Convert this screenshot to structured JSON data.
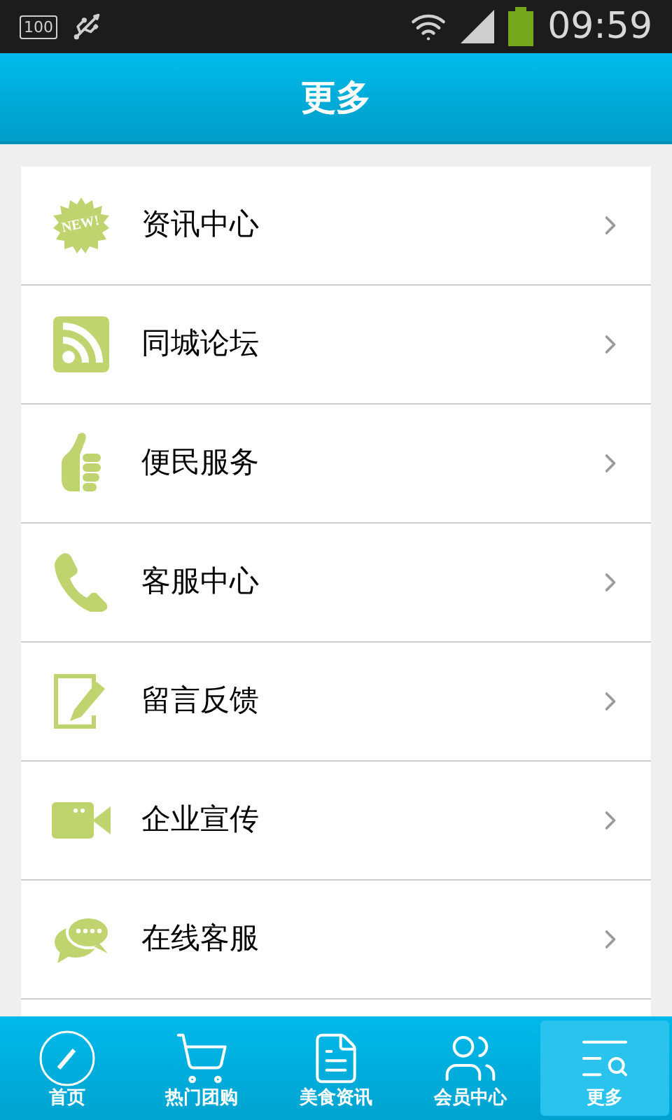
{
  "status_bar": {
    "battery_label": "100",
    "time": "09:59"
  },
  "header": {
    "title": "更多"
  },
  "menu": [
    {
      "icon_text": "NEW!",
      "label": "资讯中心"
    },
    {
      "label": "同城论坛"
    },
    {
      "label": "便民服务"
    },
    {
      "label": "客服中心"
    },
    {
      "label": "留言反馈"
    },
    {
      "label": "企业宣传"
    },
    {
      "label": "在线客服"
    }
  ],
  "tabs": [
    {
      "label": "首页",
      "selected": false
    },
    {
      "label": "热门团购",
      "selected": false
    },
    {
      "label": "美食资讯",
      "selected": false
    },
    {
      "label": "会员中心",
      "selected": false
    },
    {
      "label": "更多",
      "selected": true
    }
  ]
}
